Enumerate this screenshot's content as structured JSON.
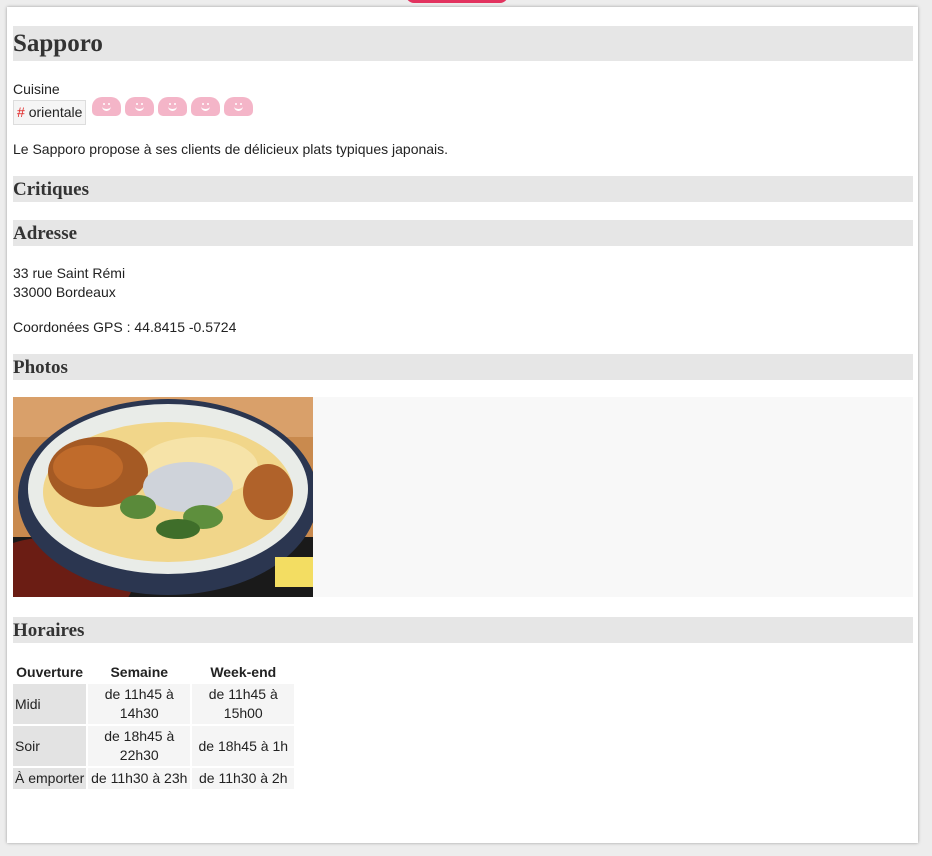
{
  "restaurant": {
    "name": "Sapporo",
    "cuisine_label": "Cuisine",
    "tag_hash": "#",
    "tag_label": "orientale",
    "rating": 5,
    "rating_max": 5,
    "description": "Le Sapporo propose à ses clients de délicieux plats typiques japonais."
  },
  "sections": {
    "critiques": "Critiques",
    "adresse": "Adresse",
    "photos": "Photos",
    "horaires": "Horaires"
  },
  "address": {
    "line1": "33 rue Saint Rémi",
    "line2": "33000 Bordeaux",
    "gps": "Coordonées GPS : 44.8415 -0.5724"
  },
  "hours": {
    "headers": [
      "Ouverture",
      "Semaine",
      "Week-end"
    ],
    "rows": [
      {
        "label": "Midi",
        "semaine": "de 11h45 à 14h30",
        "weekend": "de 11h45 à 15h00"
      },
      {
        "label": "Soir",
        "semaine": "de 18h45 à 22h30",
        "weekend": "de 18h45 à 1h"
      },
      {
        "label": "À emporter",
        "semaine": "de 11h30 à 23h",
        "weekend": "de 11h30 à 2h"
      }
    ]
  },
  "colors": {
    "accent_tab": "#e2335f",
    "rating_face": "#f4b5c8",
    "heading_bg": "#e6e6e6"
  },
  "icons": {
    "rating": "smiley-face-icon"
  }
}
